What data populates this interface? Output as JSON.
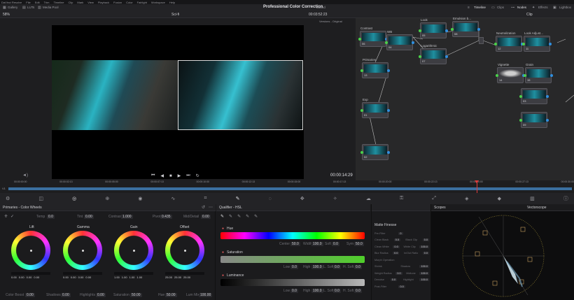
{
  "menubar": {
    "items": [
      "DaVinci Resolve",
      "File",
      "Edit",
      "Trim",
      "Timeline",
      "Clip",
      "Mark",
      "View",
      "Playback",
      "Fusion",
      "Color",
      "Fairlight",
      "Workspace",
      "Help"
    ]
  },
  "toolbar": {
    "gallery": "Gallery",
    "luts": "LUTs",
    "media_pool": "Media Pool",
    "project_title": "Professional Color Correction",
    "edited": "Edited",
    "timeline": "Timeline",
    "clips": "Clips",
    "nodes": "Nodes",
    "effects": "Effects",
    "lightbox": "Lightbox"
  },
  "viewer": {
    "zoom": "58%",
    "clip_name": "Sci-fi",
    "timecode_top": "00:03:52:23",
    "versions": "Versions - Original",
    "timecode": "00:00:14:29"
  },
  "nodes_panel": {
    "mode": "Clip",
    "nodes": [
      {
        "label": "Contrast",
        "num": "06"
      },
      {
        "label": "Primaries",
        "num": "13"
      },
      {
        "label": "WB",
        "num": "04"
      },
      {
        "label": "Look",
        "num": "05"
      },
      {
        "label": "Emulsion b...",
        "num": "08"
      },
      {
        "label": "Logarithmic",
        "num": "07"
      },
      {
        "label": "Neutralization",
        "num": "12"
      },
      {
        "label": "Look Adjust...",
        "num": "11"
      },
      {
        "label": "Vignette",
        "num": "14"
      },
      {
        "label": "Grain",
        "num": "15"
      },
      {
        "label": "Exp",
        "num": "01"
      },
      {
        "label": "",
        "num": "02"
      },
      {
        "label": "",
        "num": "03"
      },
      {
        "label": "",
        "num": "09"
      },
      {
        "label": "",
        "num": "10"
      }
    ]
  },
  "timeline": {
    "ticks": [
      "00:00:00:00",
      "00:00:02:13",
      "00:00:05:00",
      "00:00:07:13",
      "00:00:10:00",
      "00:00:12:13",
      "00:00:15:00",
      "00:00:17:13",
      "00:00:20:00",
      "00:00:22:13",
      "00:00:25:00",
      "00:00:27:13",
      "00:00:30:00"
    ],
    "track": "V1"
  },
  "primaries": {
    "title": "Primaries - Color Wheels",
    "temp_label": "Temp",
    "temp": "0.0",
    "tint_label": "Tint",
    "tint": "0.00",
    "contrast_label": "Contrast",
    "contrast": "1.000",
    "pivot_label": "Pivot",
    "pivot": "0.435",
    "middetail_label": "Mid/Detail",
    "middetail": "0.00",
    "wheels": [
      {
        "name": "Lift",
        "values": [
          "0.00",
          "0.00",
          "0.00",
          "0.00"
        ]
      },
      {
        "name": "Gamma",
        "values": [
          "0.00",
          "0.00",
          "0.00",
          "0.00"
        ]
      },
      {
        "name": "Gain",
        "values": [
          "1.00",
          "1.00",
          "1.00",
          "1.00"
        ]
      },
      {
        "name": "Offset",
        "values": [
          "25.00",
          "25.00",
          "25.00"
        ]
      }
    ],
    "colorboost_label": "Color Boost",
    "colorboost": "0.00",
    "shadows_label": "Shadows",
    "shadows": "0.00",
    "highlights_label": "Highlights",
    "highlights": "0.00",
    "saturation_label": "Saturation",
    "saturation": "50.00",
    "hue_label": "Hue",
    "hue": "50.00",
    "lummix_label": "Lum Mix",
    "lummix": "100.00"
  },
  "qualifier": {
    "title": "Qualifier - HSL",
    "hue_label": "Hue",
    "center_label": "Center",
    "center": "50.0",
    "width_label": "Width",
    "width": "100.0",
    "soft_label": "Soft",
    "soft": "0.0",
    "sym_label": "Sym",
    "sym": "50.0",
    "saturation_label": "Saturation",
    "luminance_label": "Luminance",
    "low_label": "Low",
    "low": "0.0",
    "high_label": "High",
    "high": "100.0",
    "lsoft_label": "L. Soft",
    "lsoft": "0.0",
    "hsoft_label": "H. Soft",
    "hsoft": "0.0"
  },
  "matte": {
    "title": "Matte Finesse",
    "rows": [
      {
        "a": "Pre-Filter",
        "av": "0",
        "b": "",
        "bv": ""
      },
      {
        "a": "Clean Black",
        "av": "0.0",
        "b": "Black Clip",
        "bv": "0.0"
      },
      {
        "a": "Clean White",
        "av": "0.0",
        "b": "White Clip",
        "bv": "100.0"
      },
      {
        "a": "Blur Radius",
        "av": "0.0",
        "b": "In/Out Ratio",
        "bv": "0.0"
      },
      {
        "a": "Morph Operation",
        "av": "",
        "b": "",
        "bv": ""
      },
      {
        "a": "Shrink",
        "av": "",
        "b": "Shadow",
        "bv": "100.0"
      },
      {
        "a": "Weight Radius",
        "av": "0.0",
        "b": "Midtone",
        "bv": "100.0"
      },
      {
        "a": "Denoise",
        "av": "0.0",
        "b": "Highlight",
        "bv": "100.0"
      },
      {
        "a": "Post-Filter",
        "av": "0.0",
        "b": "",
        "bv": ""
      }
    ]
  },
  "scopes": {
    "title": "Scopes",
    "mode": "Vectorscope"
  },
  "colors": {
    "accent": "#e05a5a",
    "panel": "#1b1b1d",
    "playhead": "#e23c3c"
  }
}
